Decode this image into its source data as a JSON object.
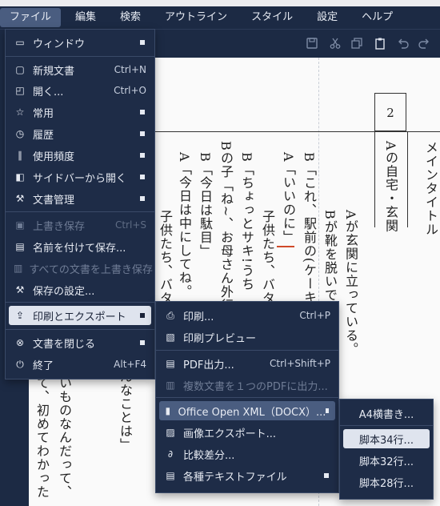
{
  "menubar": {
    "items": [
      "ファイル",
      "編集",
      "検索",
      "アウトライン",
      "スタイル",
      "設定",
      "ヘルプ"
    ]
  },
  "toolbar": {
    "icons": [
      "save-icon",
      "cut-icon",
      "copy-icon",
      "paste-icon",
      "undo-icon",
      "redo-icon"
    ]
  },
  "document": {
    "scene_number": "2",
    "scene_heading": "Aの自宅・玄関",
    "main_title": "メインタイトル",
    "columns": [
      "Aが玄関に立っている。",
      "Bが靴を脱いで",
      "B「これ、駅前の(ケーキ",
      "A「いいのに」",
      "子供たち、バタ",
      "B「ちょっとサキ!うち",
      "Bの子「ね~、お母さん外行",
      "B「今日は駄目」",
      "A「今日は中にしてね。",
      "子供たち、バタ",
      "んなことは」",
      "いものなんだって、",
      "て、初めてわかった"
    ]
  },
  "file_menu": {
    "items": [
      {
        "label": "ウィンドウ",
        "shortcut": "",
        "submenu": true
      },
      {
        "label": "新規文書",
        "shortcut": "Ctrl+N"
      },
      {
        "label": "開く...",
        "shortcut": "Ctrl+O"
      },
      {
        "label": "常用",
        "shortcut": "",
        "submenu": true
      },
      {
        "label": "履歴",
        "shortcut": "",
        "submenu": true
      },
      {
        "label": "使用頻度",
        "shortcut": "",
        "submenu": true
      },
      {
        "label": "サイドバーから開く",
        "shortcut": "",
        "submenu": true
      },
      {
        "label": "文書管理",
        "shortcut": "",
        "submenu": true
      },
      {
        "label": "上書き保存",
        "shortcut": "Ctrl+S",
        "disabled": true
      },
      {
        "label": "名前を付けて保存...",
        "shortcut": ""
      },
      {
        "label": "すべての文書を上書き保存",
        "shortcut": "",
        "disabled": true
      },
      {
        "label": "保存の設定...",
        "shortcut": ""
      },
      {
        "label": "印刷とエクスポート",
        "shortcut": "",
        "submenu": true
      },
      {
        "label": "文書を閉じる",
        "shortcut": "",
        "submenu": true
      },
      {
        "label": "終了",
        "shortcut": "Alt+F4"
      }
    ]
  },
  "export_menu": {
    "items": [
      {
        "label": "印刷...",
        "shortcut": "Ctrl+P"
      },
      {
        "label": "印刷プレビュー",
        "shortcut": ""
      },
      {
        "label": "PDF出力...",
        "shortcut": "Ctrl+Shift+P"
      },
      {
        "label": "複数文書を１つのPDFに出力...",
        "shortcut": "",
        "disabled": true
      },
      {
        "label": "Office Open XML（DOCX）...",
        "shortcut": "",
        "submenu": true
      },
      {
        "label": "画像エクスポート...",
        "shortcut": ""
      },
      {
        "label": "比較差分...",
        "shortcut": ""
      },
      {
        "label": "各種テキストファイル",
        "shortcut": "",
        "submenu": true
      }
    ]
  },
  "docx_menu": {
    "items": [
      {
        "label": "A4横書き..."
      },
      {
        "label": "脚本34行..."
      },
      {
        "label": "脚本32行..."
      },
      {
        "label": "脚本28行..."
      }
    ]
  }
}
